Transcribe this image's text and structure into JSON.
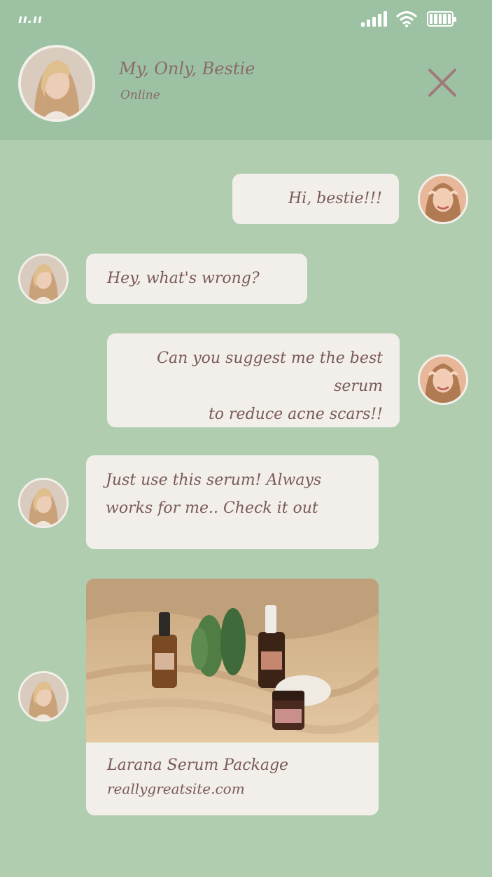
{
  "status_bar": {
    "carrier": "ıı.ıı"
  },
  "header": {
    "title": "My, Only, Bestie",
    "status": "Online"
  },
  "messages": [
    {
      "side": "right",
      "text_lines": [
        "Hi, bestie!!!"
      ]
    },
    {
      "side": "left",
      "text_lines": [
        "Hey, what's wrong?"
      ]
    },
    {
      "side": "right",
      "text_lines": [
        "Can you suggest me the best serum",
        "to reduce acne scars!!"
      ]
    },
    {
      "side": "left",
      "text_lines": [
        "Just use this serum! Always",
        "works for me.. Check it out"
      ]
    }
  ],
  "link_card": {
    "title": "Larana Serum Package",
    "url": "reallygreatsite.com"
  },
  "colors": {
    "background": "#b0cdb0",
    "header": "#9dc2a3",
    "bubble": "#f2efea",
    "text": "#7a5a58"
  }
}
